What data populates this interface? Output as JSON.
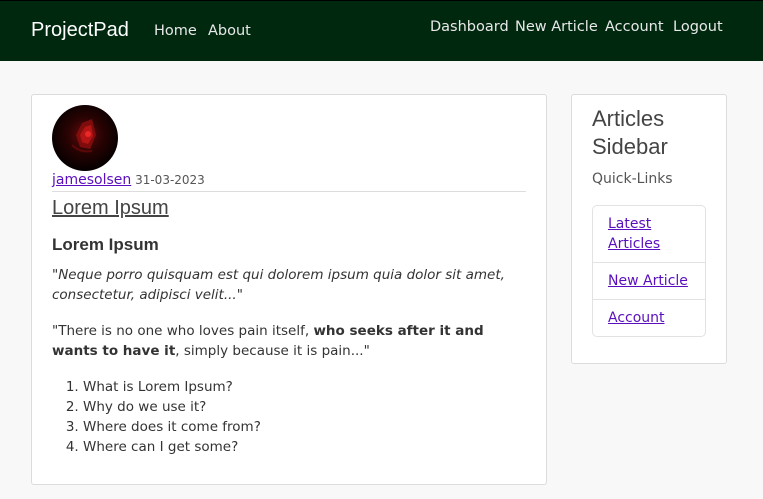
{
  "navbar": {
    "brand": "ProjectPad",
    "left_links": [
      "Home",
      "About"
    ],
    "right_links": [
      "Dashboard",
      "New Article",
      "Account",
      "Logout"
    ],
    "bg_color": "#00280f"
  },
  "article": {
    "author": "jamesolsen",
    "date": "31-03-2023",
    "link_title": "Lorem Ipsum",
    "heading": "Lorem Ipsum",
    "quote": "\"Neque porro quisquam est qui dolorem ipsum quia dolor sit amet, consectetur, adipisci velit...\"",
    "para_start": "\"There is no one who loves pain itself, ",
    "para_bold": "who seeks after it and wants to have it",
    "para_end": ", simply because it is pain...\"",
    "list": [
      "What is Lorem Ipsum?",
      "Why do we use it?",
      "Where does it come from?",
      "Where can I get some?"
    ]
  },
  "sidebar": {
    "title": "Articles Sidebar",
    "subtitle": "Quick-Links",
    "links": [
      "Latest Articles",
      "New Article",
      "Account"
    ]
  },
  "colors": {
    "link": "#5a0fbf"
  }
}
